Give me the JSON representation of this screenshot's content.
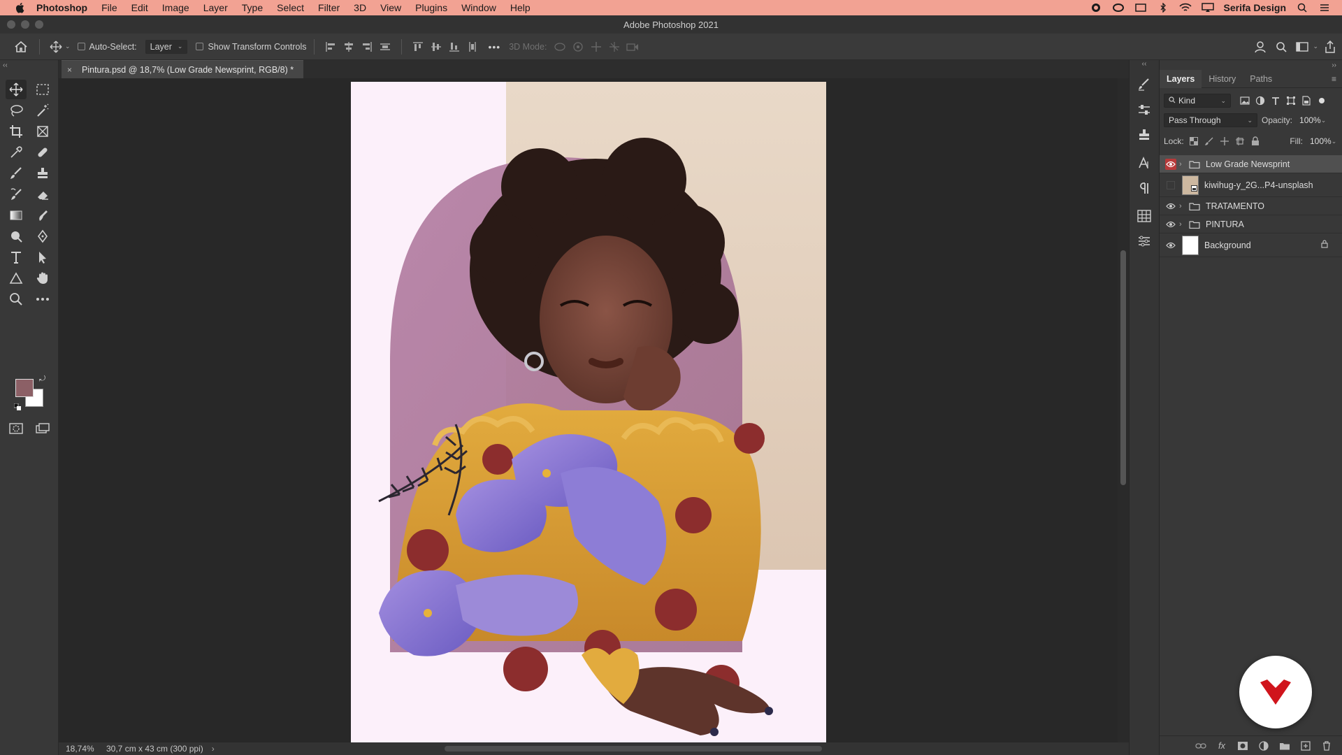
{
  "menubar": {
    "app_name": "Photoshop",
    "items": [
      "File",
      "Edit",
      "Image",
      "Layer",
      "Type",
      "Select",
      "Filter",
      "3D",
      "View",
      "Plugins",
      "Window",
      "Help"
    ],
    "account": "Serifa Design",
    "bg_color": "#f2a293"
  },
  "window": {
    "title": "Adobe Photoshop 2021"
  },
  "options_bar": {
    "auto_select_label": "Auto-Select:",
    "auto_select_target": "Layer",
    "transform_controls_label": "Show Transform Controls",
    "more_label": "•••",
    "mode_3d_label": "3D Mode:"
  },
  "document": {
    "tab_title": "Pintura.psd @ 18,7% (Low Grade Newsprint, RGB/8) *",
    "close_glyph": "×"
  },
  "status": {
    "zoom": "18,74%",
    "dimensions": "30,7 cm x 43 cm (300 ppi)",
    "arrow": "›"
  },
  "layers_panel": {
    "tabs": [
      "Layers",
      "History",
      "Paths"
    ],
    "filter_kind": "Kind",
    "blend_mode": "Pass Through",
    "opacity_label": "Opacity:",
    "opacity_value": "100%",
    "lock_label": "Lock:",
    "fill_label": "Fill:",
    "fill_value": "100%",
    "layers": [
      {
        "name": "Low Grade Newsprint",
        "type": "group",
        "visible": true,
        "selected": true
      },
      {
        "name": "kiwihug-y_2G...P4-unsplash",
        "type": "smart-object",
        "visible": false
      },
      {
        "name": "TRATAMENTO",
        "type": "group",
        "visible": true
      },
      {
        "name": "PINTURA",
        "type": "group",
        "visible": true
      },
      {
        "name": "Background",
        "type": "pixel",
        "visible": true,
        "locked": true
      }
    ]
  },
  "colors": {
    "foreground": "#8c6066",
    "background": "#ffffff",
    "selected_eye": "#b73a3a",
    "badge_mark": "#d0141c"
  }
}
